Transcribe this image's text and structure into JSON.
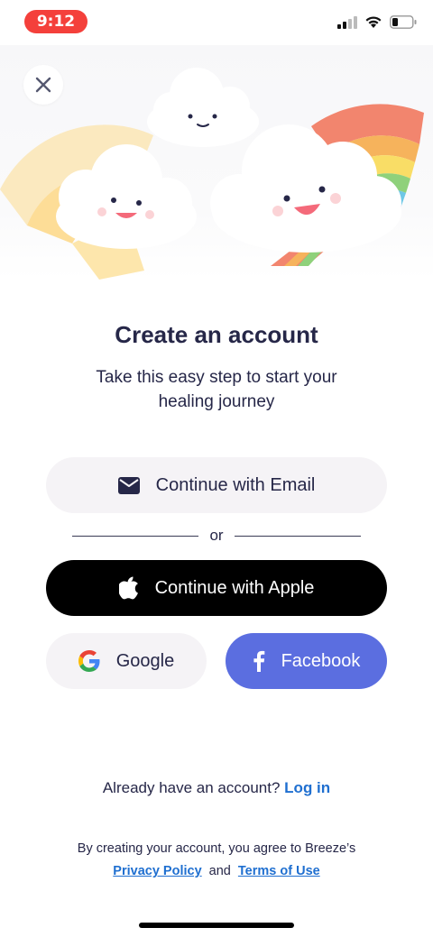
{
  "status_bar": {
    "time": "9:12"
  },
  "header": {
    "close_icon": "close-icon"
  },
  "main": {
    "title": "Create an account",
    "subtitle": "Take this easy step to start your healing journey"
  },
  "buttons": {
    "email": "Continue with Email",
    "divider_or": "or",
    "apple": "Continue with Apple",
    "google": "Google",
    "facebook": "Facebook"
  },
  "footer": {
    "login_prompt": "Already have an account?",
    "login_link": "Log in",
    "legal_text": "By creating your account, you agree to Breeze’s",
    "privacy": "Privacy Policy",
    "and": "and",
    "terms": "Terms of Use"
  },
  "colors": {
    "accent_link": "#1f6fd0",
    "facebook": "#5b6ee0",
    "title": "#262748",
    "time_pill": "#f4403b"
  }
}
